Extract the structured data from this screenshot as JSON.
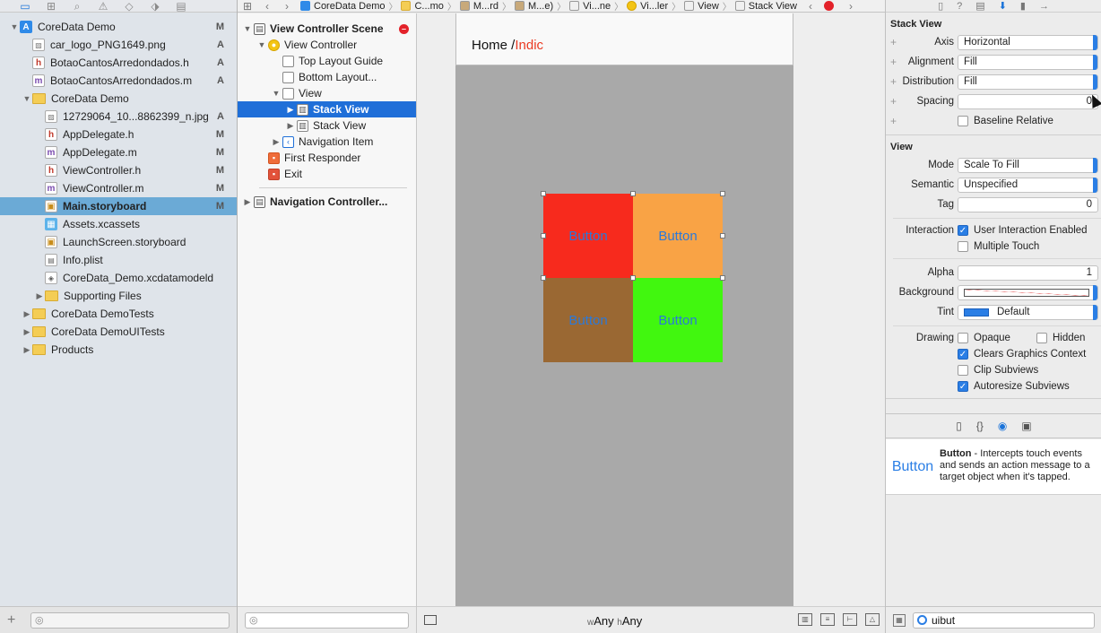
{
  "navigator": {
    "toolbar_icons": [
      "folder-icon",
      "symbol-icon",
      "search-icon",
      "warning-icon",
      "test-icon",
      "breakpoint-icon",
      "report-icon"
    ],
    "tree": [
      {
        "label": "CoreData Demo",
        "icon": "proj",
        "disc": "▼",
        "indent": 0,
        "badge": "M",
        "bold": false,
        "selected": false
      },
      {
        "label": "car_logo_PNG1649.png",
        "icon": "img",
        "disc": "",
        "indent": 1,
        "badge": "A",
        "bold": false,
        "selected": false
      },
      {
        "label": "BotaoCantosArredondados.h",
        "icon": "hfile",
        "disc": "",
        "indent": 1,
        "badge": "A",
        "bold": false,
        "selected": false
      },
      {
        "label": "BotaoCantosArredondados.m",
        "icon": "mfile",
        "disc": "",
        "indent": 1,
        "badge": "A",
        "bold": false,
        "selected": false
      },
      {
        "label": "CoreData Demo",
        "icon": "folder",
        "disc": "▼",
        "indent": 1,
        "badge": "",
        "bold": false,
        "selected": false
      },
      {
        "label": "12729064_10...8862399_n.jpg",
        "icon": "img",
        "disc": "",
        "indent": 2,
        "badge": "A",
        "bold": false,
        "selected": false
      },
      {
        "label": "AppDelegate.h",
        "icon": "hfile",
        "disc": "",
        "indent": 2,
        "badge": "M",
        "bold": false,
        "selected": false
      },
      {
        "label": "AppDelegate.m",
        "icon": "mfile",
        "disc": "",
        "indent": 2,
        "badge": "M",
        "bold": false,
        "selected": false
      },
      {
        "label": "ViewController.h",
        "icon": "hfile",
        "disc": "",
        "indent": 2,
        "badge": "M",
        "bold": false,
        "selected": false
      },
      {
        "label": "ViewController.m",
        "icon": "mfile",
        "disc": "",
        "indent": 2,
        "badge": "M",
        "bold": false,
        "selected": false
      },
      {
        "label": "Main.storyboard",
        "icon": "story",
        "disc": "",
        "indent": 2,
        "badge": "M",
        "bold": true,
        "selected": true
      },
      {
        "label": "Assets.xcassets",
        "icon": "assets",
        "disc": "",
        "indent": 2,
        "badge": "",
        "bold": false,
        "selected": false
      },
      {
        "label": "LaunchScreen.storyboard",
        "icon": "story",
        "disc": "",
        "indent": 2,
        "badge": "",
        "bold": false,
        "selected": false
      },
      {
        "label": "Info.plist",
        "icon": "plist",
        "disc": "",
        "indent": 2,
        "badge": "",
        "bold": false,
        "selected": false
      },
      {
        "label": "CoreData_Demo.xcdatamodeld",
        "icon": "model",
        "disc": "",
        "indent": 2,
        "badge": "",
        "bold": false,
        "selected": false
      },
      {
        "label": "Supporting Files",
        "icon": "folder",
        "disc": "▶",
        "indent": 2,
        "badge": "",
        "bold": false,
        "selected": false
      },
      {
        "label": "CoreData DemoTests",
        "icon": "folder",
        "disc": "▶",
        "indent": 1,
        "badge": "",
        "bold": false,
        "selected": false
      },
      {
        "label": "CoreData DemoUITests",
        "icon": "folder",
        "disc": "▶",
        "indent": 1,
        "badge": "",
        "bold": false,
        "selected": false
      },
      {
        "label": "Products",
        "icon": "folder",
        "disc": "▶",
        "indent": 1,
        "badge": "",
        "bold": false,
        "selected": false
      }
    ]
  },
  "jumpbar": {
    "crumbs": [
      {
        "label": "CoreData Demo",
        "icon": "proj"
      },
      {
        "label": "C...mo",
        "icon": "folder"
      },
      {
        "label": "M...rd",
        "icon": "story"
      },
      {
        "label": "M...e)",
        "icon": "story"
      },
      {
        "label": "Vi...ne",
        "icon": "scene"
      },
      {
        "label": "Vi...ler",
        "icon": "vc"
      },
      {
        "label": "View",
        "icon": "view"
      },
      {
        "label": "Stack View",
        "icon": "stack"
      }
    ]
  },
  "outline": {
    "rows": [
      {
        "label": "View Controller Scene",
        "icon": "scene",
        "glyph": "▤",
        "disc": "▼",
        "indent": 0,
        "bold": true,
        "selected": false,
        "error": true
      },
      {
        "label": "View Controller",
        "icon": "vc",
        "glyph": "●",
        "disc": "▼",
        "indent": 1,
        "bold": false,
        "selected": false,
        "error": false
      },
      {
        "label": "Top Layout Guide",
        "icon": "guide",
        "glyph": "",
        "disc": "",
        "indent": 2,
        "bold": false,
        "selected": false,
        "error": false
      },
      {
        "label": "Bottom Layout...",
        "icon": "guide",
        "glyph": "",
        "disc": "",
        "indent": 2,
        "bold": false,
        "selected": false,
        "error": false
      },
      {
        "label": "View",
        "icon": "view",
        "glyph": "",
        "disc": "▼",
        "indent": 2,
        "bold": false,
        "selected": false,
        "error": false
      },
      {
        "label": "Stack View",
        "icon": "stack",
        "glyph": "▥",
        "disc": "▶",
        "indent": 3,
        "bold": true,
        "selected": true,
        "error": false
      },
      {
        "label": "Stack View",
        "icon": "stack",
        "glyph": "▥",
        "disc": "▶",
        "indent": 3,
        "bold": false,
        "selected": false,
        "error": false
      },
      {
        "label": "Navigation Item",
        "icon": "nav",
        "glyph": "‹",
        "disc": "▶",
        "indent": 2,
        "bold": false,
        "selected": false,
        "error": false
      },
      {
        "label": "First Responder",
        "icon": "responder",
        "glyph": "▪",
        "disc": "",
        "indent": 1,
        "bold": false,
        "selected": false,
        "error": false
      },
      {
        "label": "Exit",
        "icon": "exit",
        "glyph": "▪",
        "disc": "",
        "indent": 1,
        "bold": false,
        "selected": false,
        "error": false
      }
    ],
    "second_scene": {
      "label": "Navigation Controller...",
      "disc": "▶"
    }
  },
  "canvas": {
    "nav_title_prefix": "Home /",
    "nav_title_accent": "Indic",
    "buttons": [
      {
        "label": "Button",
        "color": "#f72a1d"
      },
      {
        "label": "Button",
        "color": "#f9a345"
      },
      {
        "label": "Button",
        "color": "#9a6833"
      },
      {
        "label": "Button",
        "color": "#41f70f"
      }
    ],
    "size_class": {
      "w_prefix": "w",
      "w_value": "Any",
      "h_prefix": "h",
      "h_value": "Any"
    }
  },
  "inspector": {
    "tabs": [
      "file-icon",
      "help-icon",
      "identity-icon",
      "attributes-icon",
      "size-icon",
      "connections-icon"
    ],
    "stack_view": {
      "title": "Stack View",
      "axis_label": "Axis",
      "axis": "Horizontal",
      "alignment_label": "Alignment",
      "alignment": "Fill",
      "distribution_label": "Distribution",
      "distribution": "Fill",
      "spacing_label": "Spacing",
      "spacing": "0",
      "baseline_label": "Baseline Relative"
    },
    "view": {
      "title": "View",
      "mode_label": "Mode",
      "mode": "Scale To Fill",
      "semantic_label": "Semantic",
      "semantic": "Unspecified",
      "tag_label": "Tag",
      "tag": "0",
      "interaction_label": "Interaction",
      "user_interaction": "User Interaction Enabled",
      "multiple_touch": "Multiple Touch",
      "alpha_label": "Alpha",
      "alpha": "1",
      "background_label": "Background",
      "tint_label": "Tint",
      "tint": "Default",
      "drawing_label": "Drawing",
      "opaque": "Opaque",
      "hidden": "Hidden",
      "clears": "Clears Graphics Context",
      "clip": "Clip Subviews",
      "autoresize": "Autoresize Subviews"
    },
    "library": {
      "icon_label": "Button",
      "title": "Button",
      "description": " - Intercepts touch events and sends an action message to a target object when it's tapped.",
      "filter_value": "uibut"
    }
  }
}
